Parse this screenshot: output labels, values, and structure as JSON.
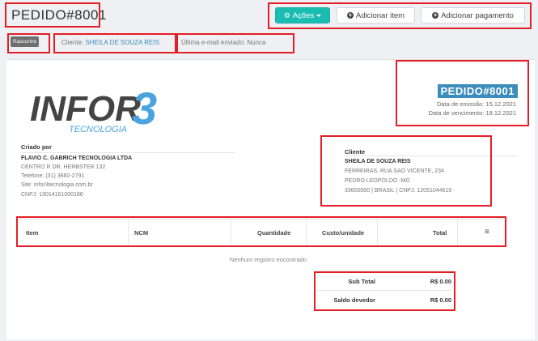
{
  "header": {
    "title": "PEDIDO#8001"
  },
  "toolbar": {
    "actions_label": "Ações",
    "add_item_label": "Adicionar item",
    "add_payment_label": "Adicionar pagamento"
  },
  "status_bar": {
    "draft_badge": "Rascunho",
    "client_prefix": "Cliente:",
    "client_name": "SHEILA DE SOUZA REIS",
    "last_email": "Última e-mail enviado: Nunca"
  },
  "logo": {
    "main": "INFOR",
    "numeral": "3",
    "sub": "TECNOLOGIA"
  },
  "invoice": {
    "number": "PEDIDO#8001",
    "issue_date": "Data de emissão: 15.12.2021",
    "due_date": "Data de vencimento: 18.12.2021"
  },
  "created_by": {
    "label": "Criado por",
    "company": "FLAVIO C. GABRICH TECNOLOGIA LTDA",
    "address": "CENTRO R DR. HERBSTER 132",
    "phone": "Telefone: (31) 3660-2791",
    "site": "Site: infor3tecnologia.com.br",
    "cnpj": "CNPJ: 13014161000186"
  },
  "client": {
    "label": "Cliente",
    "name": "SHEILA DE SOUZA REIS",
    "street": "FERREIRAS, RUA SAO VICENTE, 234",
    "city": "PEDRO LEOPOLDO -MG",
    "zip_country": "33600000 | BRASIL | CNPJ: 12051044619"
  },
  "table": {
    "columns": [
      "Item",
      "NCM",
      "Quantidade",
      "Custo/unidade",
      "Total"
    ],
    "menu_icon": "≡",
    "empty_message": "Nenhum registro encontrado."
  },
  "totals": {
    "subtotal_label": "Sub Total",
    "subtotal_value": "R$ 0.00",
    "balance_label": "Saldo devedor",
    "balance_value": "R$ 0.00"
  },
  "colors": {
    "accent": "#1bbdb3",
    "badge_blue": "#3c8dbc",
    "highlight": "#e41e26"
  }
}
